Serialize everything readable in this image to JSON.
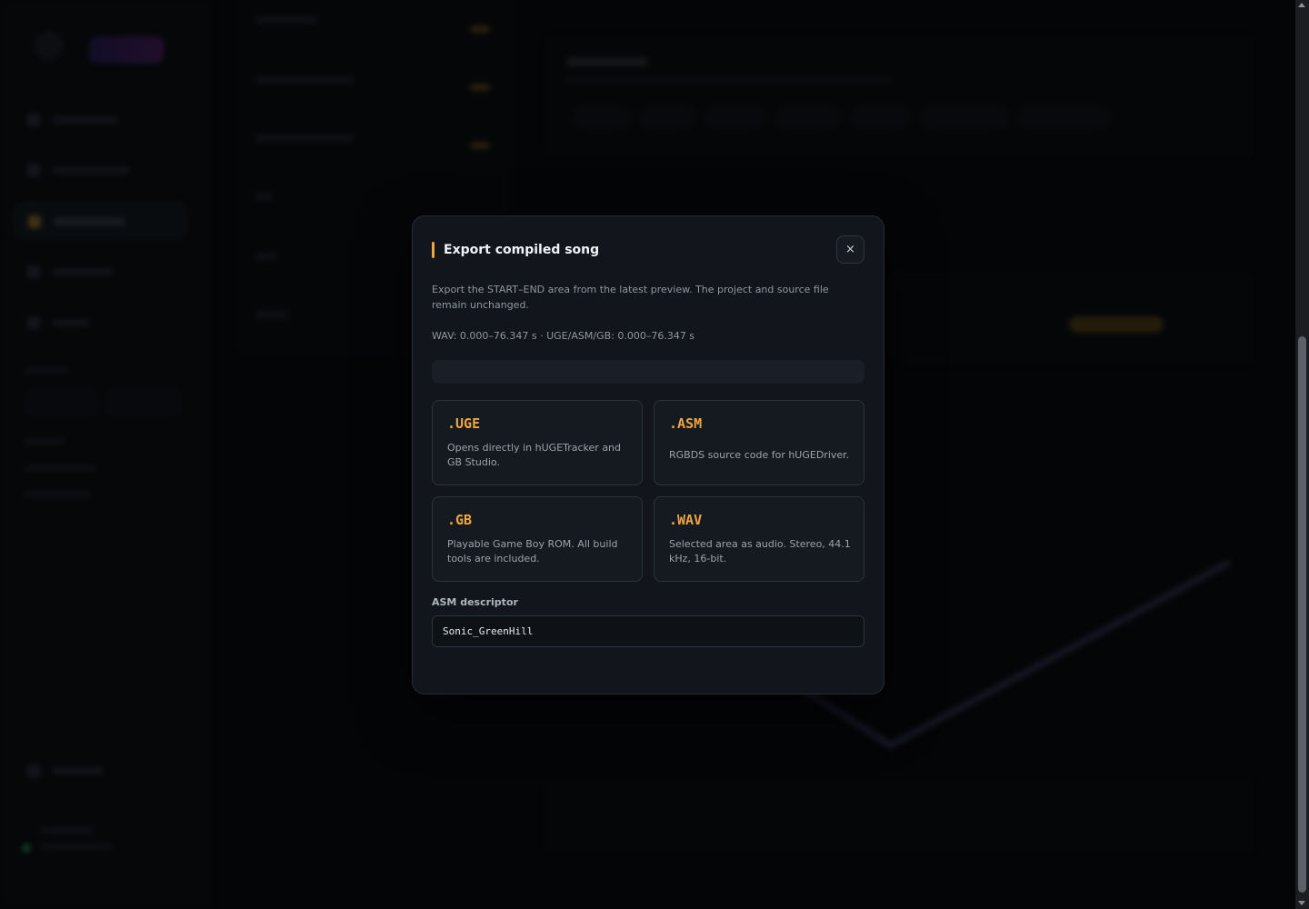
{
  "modal": {
    "title": "Export compiled song",
    "close_label": "×",
    "description": "Export the START–END area from the latest preview. The project and source file remain unchanged.",
    "range": "WAV: 0.000–76.347 s · UGE/ASM/GB: 0.000–76.347 s",
    "formats": [
      {
        "ext": ".UGE",
        "desc": "Opens directly in hUGETracker and GB Studio."
      },
      {
        "ext": ".ASM",
        "desc": "RGBDS source code for hUGEDriver."
      },
      {
        "ext": ".GB",
        "desc": "Playable Game Boy ROM. All build tools are included."
      },
      {
        "ext": ".WAV",
        "desc": "Selected area as audio. Stereo, 44.1 kHz, 16-bit."
      }
    ],
    "asm_descriptor": {
      "label": "ASM descriptor",
      "value": "Sonic_GreenHill"
    }
  },
  "colors": {
    "accent": "#f0a540",
    "modal_bg": "#12161c",
    "page_bg": "#0a0c10"
  },
  "icons": {
    "close": "close-icon"
  }
}
